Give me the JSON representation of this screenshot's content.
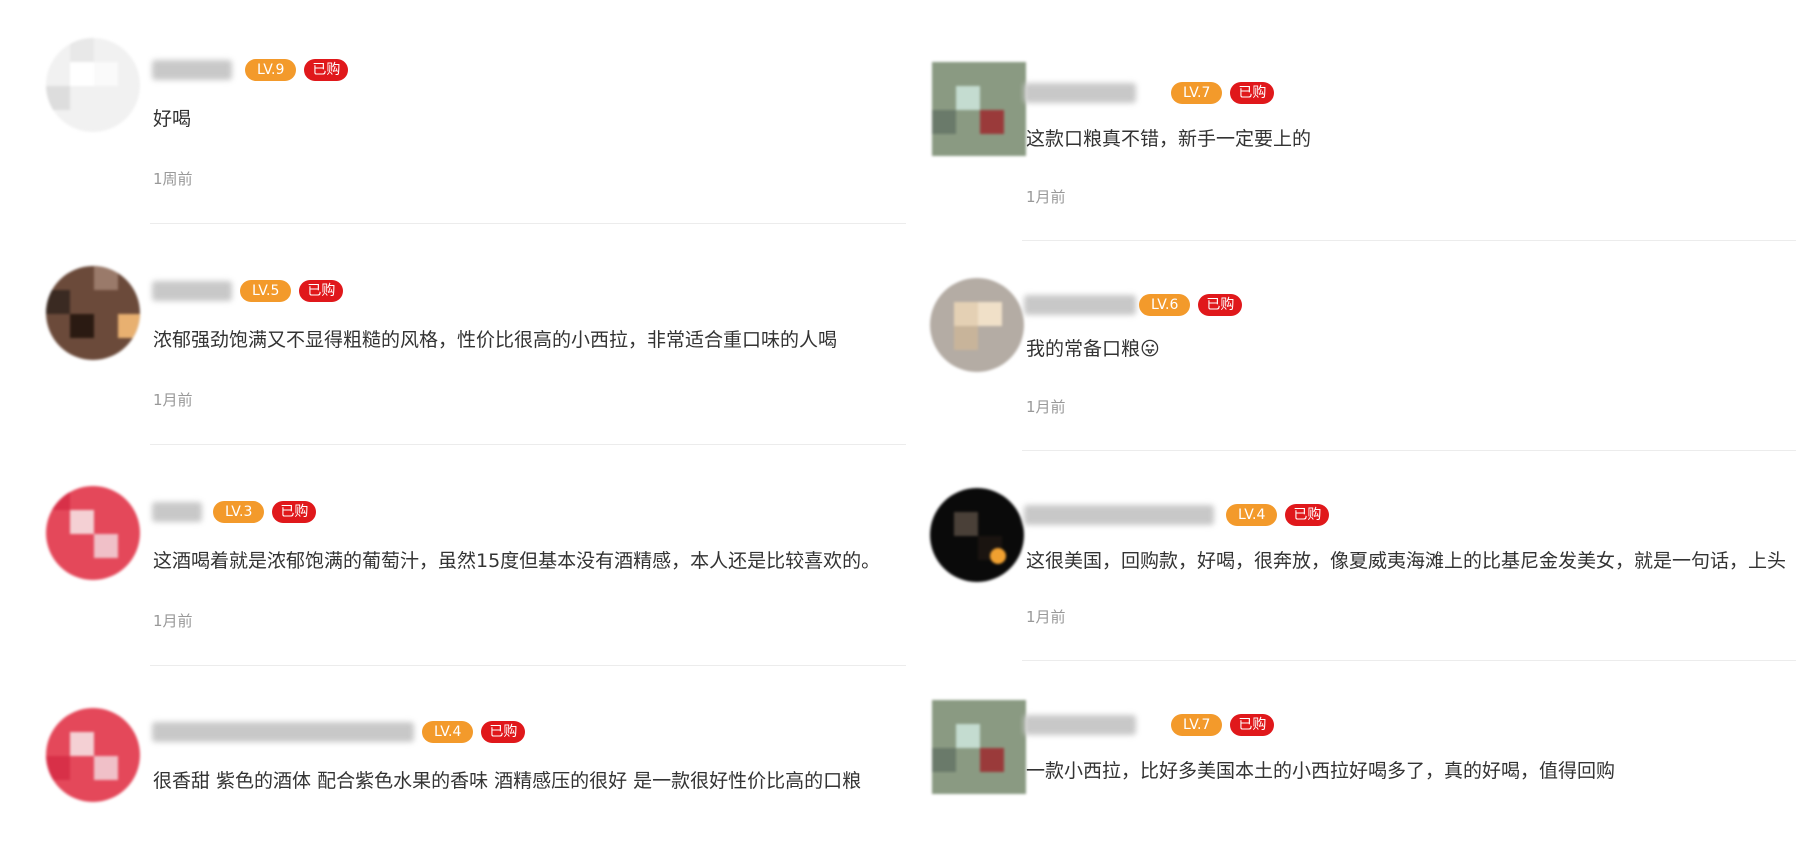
{
  "reviews_left": [
    {
      "level": "LV.9",
      "bought": "已购",
      "text": "好喝",
      "time": "1周前"
    },
    {
      "level": "LV.5",
      "bought": "已购",
      "text": "浓郁强劲饱满又不显得粗糙的风格，性价比很高的小西拉，非常适合重口味的人喝",
      "time": "1月前"
    },
    {
      "level": "LV.3",
      "bought": "已购",
      "text": "这酒喝着就是浓郁饱满的葡萄汁，虽然15度但基本没有酒精感，本人还是比较喜欢的。",
      "time": "1月前"
    },
    {
      "level": "LV.4",
      "bought": "已购",
      "text": "很香甜 紫色的酒体 配合紫色水果的香味 酒精感压的很好 是一款很好性价比高的口粮",
      "time": ""
    }
  ],
  "reviews_right": [
    {
      "level": "LV.7",
      "bought": "已购",
      "text": "这款口粮真不错，新手一定要上的",
      "time": "1月前"
    },
    {
      "level": "LV.6",
      "bought": "已购",
      "text": "我的常备口粮😛",
      "time": "1月前"
    },
    {
      "level": "LV.4",
      "bought": "已购",
      "text": "这很美国，回购款，好喝，很奔放，像夏威夷海滩上的比基尼金发美女，就是一句话，上头",
      "time": "1月前"
    },
    {
      "level": "LV.7",
      "bought": "已购",
      "text": "一款小西拉，比好多美国本土的小西拉好喝多了，真的好喝，值得回购",
      "time": ""
    }
  ],
  "colors": {
    "level_badge": "#f39a2b",
    "bought_badge": "#e0181b",
    "timestamp": "#999999"
  }
}
